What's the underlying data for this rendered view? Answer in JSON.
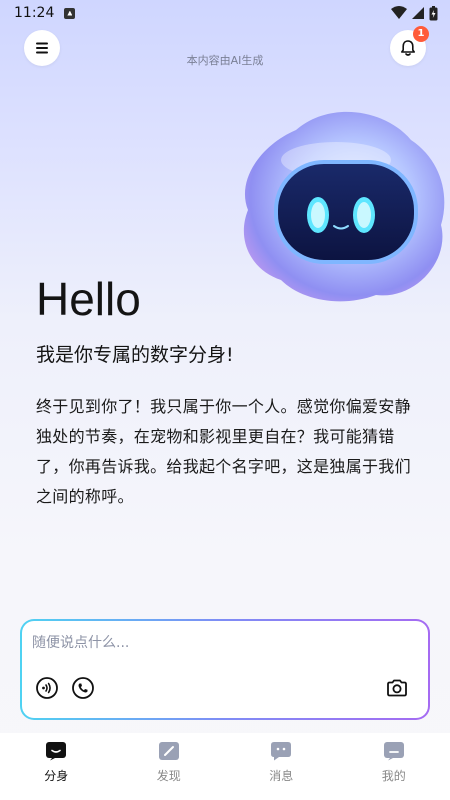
{
  "status_bar": {
    "time": "11:24"
  },
  "header": {
    "ai_notice": "本内容由AI生成",
    "notification_count": "1"
  },
  "hero": {
    "greeting": "Hello",
    "subtitle": "我是你专属的数字分身!",
    "intro": "终于见到你了！我只属于你一个人。感觉你偏爱安静独处的节奏，在宠物和影视里更自在？我可能猜错了，你再告诉我。给我起个名字吧，这是独属于我们之间的称呼。"
  },
  "composer": {
    "placeholder": "随便说点什么..."
  },
  "tabs": [
    {
      "label": "分身",
      "icon": "avatar-icon",
      "active": true
    },
    {
      "label": "发现",
      "icon": "compass-icon",
      "active": false
    },
    {
      "label": "消息",
      "icon": "chat-icon",
      "active": false
    },
    {
      "label": "我的",
      "icon": "profile-icon",
      "active": false
    }
  ],
  "colors": {
    "accent_start": "#4fd2f2",
    "accent_end": "#a56bf2",
    "badge": "#ff5b3a",
    "tab_icon_active": "#111111",
    "tab_icon_inactive": "#9aa1b5"
  }
}
